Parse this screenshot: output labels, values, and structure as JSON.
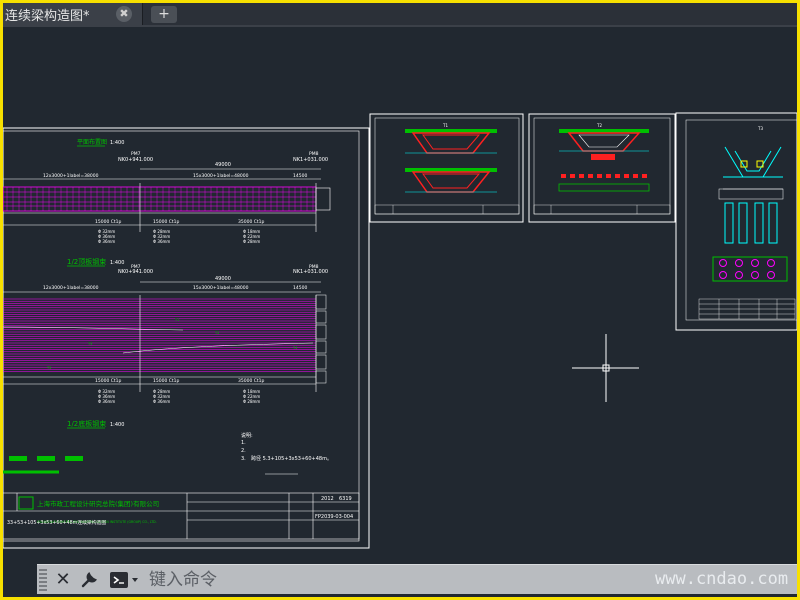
{
  "tab": {
    "title": "连续梁构造图*",
    "close_symbol": "✖",
    "new_tab_symbol": "+"
  },
  "drawing": {
    "sheet_main": {
      "plan_title": "平面布置图",
      "plan_scale": "1:400",
      "half_title_1": "1/2顶板钢束",
      "half_scale_1": "1:400",
      "half_title_2": "1/2底板钢束",
      "half_scale_2": "1:400",
      "pier_labels": [
        "PM7",
        "PM8"
      ],
      "stations": [
        "NK0+941.000",
        "NK1+031.000"
      ],
      "span_total": "49000",
      "dim_row_1": [
        "12x3000+1label=38000",
        "15x3000+1label=48000",
        "14500"
      ],
      "dim_row_2": [
        "12x3000+1label=38000",
        "15x3000+1label=48000",
        "14500"
      ],
      "bottom_dims": [
        "15000 Ct1p",
        "15000 Ct1p",
        "35000 Ct1p"
      ],
      "note_lines": [
        "说明:",
        "1.",
        "2.",
        "3.",
        "跨径 5.3+105+3x53+60+48m。"
      ],
      "company_name": "上海市政工程设计研究总院(集团)有限公司",
      "company_english": "SHANGHAI MUNICIPAL ENGINEERING DESIGN INSTITUTE (GROUP) CO., LTD.",
      "project_line": "33+53+105+3x53+60+48m连续梁构造图",
      "year": "2012",
      "drawing_no": "FP2039-03-004",
      "month_code": "6319"
    },
    "sheet_small_1": {
      "title": "T1"
    },
    "sheet_small_2": {
      "title": "T2"
    },
    "sheet_small_3": {
      "title": "T3"
    }
  },
  "colors": {
    "background": "#212830",
    "magenta": "#ff00ff",
    "green": "#00c000",
    "red": "#ff2020",
    "cyan": "#00ffff",
    "white": "#ffffff",
    "yellow_border": "#f7e000"
  },
  "command": {
    "close_symbol": "✕",
    "prompt_arrow": "▾",
    "placeholder": "键入命令"
  },
  "watermark": "www.cndao.com"
}
